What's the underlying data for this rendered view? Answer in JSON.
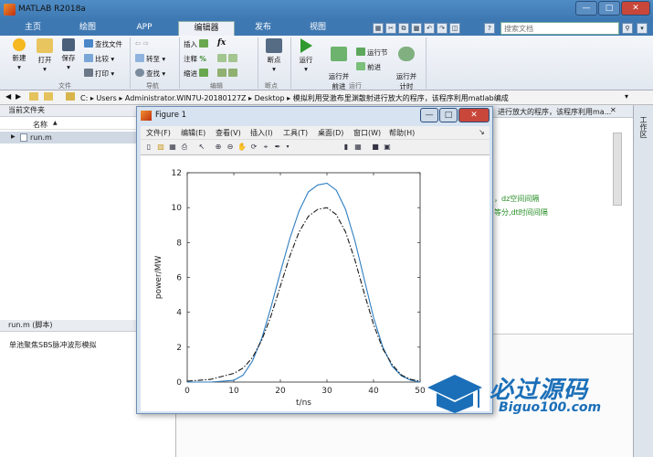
{
  "window": {
    "title": "MATLAB R2018a"
  },
  "tabs": [
    {
      "label": "主页"
    },
    {
      "label": "绘图"
    },
    {
      "label": "APP"
    },
    {
      "label": "编辑器"
    },
    {
      "label": "发布"
    },
    {
      "label": "视图"
    }
  ],
  "search": {
    "placeholder": "搜索文档"
  },
  "ribbon": {
    "file": {
      "new": "新建",
      "open": "打开",
      "save": "保存",
      "find_files": "查找文件",
      "compare": "比较",
      "print": "打印",
      "group": "文件"
    },
    "navigate": {
      "goto": "转至",
      "find": "查找",
      "group": "导航"
    },
    "edit": {
      "insert": "插入",
      "comment": "注释",
      "indent": "缩进",
      "fx": "fx",
      "group": "编辑"
    },
    "breakpoints": {
      "label": "断点",
      "group": "断点"
    },
    "run": {
      "run": "运行",
      "run_advance": "运行并\n前进",
      "run_section": "运行节",
      "advance": "前进",
      "run_time": "运行并\n计时",
      "group": "运行"
    }
  },
  "address": {
    "path": "C: ▸ Users ▸ Administrator.WIN7U-20180127Z ▸ Desktop ▸ 模拟利用受激布里渊散射进行放大的程序，该程序利用matlab编成"
  },
  "current_folder": {
    "header": "当前文件夹",
    "column_name": "名称",
    "column_sort": "▲",
    "files": [
      {
        "name": "run.m"
      }
    ]
  },
  "details": {
    "header": "run.m  (脚本)",
    "description": "单池聚焦SBS脉冲波形模拟"
  },
  "editor": {
    "tab_title": "进行放大的程序，该程序利用ma...",
    "line1": "，dz空间间隔",
    "line2": "等分,dt时间间隔"
  },
  "right_strip": {
    "label": "工作区"
  },
  "figure": {
    "title": "Figure 1",
    "menu": [
      "文件(F)",
      "编辑(E)",
      "查看(V)",
      "插入(I)",
      "工具(T)",
      "桌面(D)",
      "窗口(W)",
      "帮助(H)"
    ]
  },
  "colors": {
    "accent": "#3e78b2",
    "series1": "#2f7ec1",
    "series2": "#1a1a1a"
  },
  "watermark": {
    "title": "必过源码",
    "url": "Biguo100.com"
  },
  "chart_data": {
    "type": "line",
    "xlabel": "t/ns",
    "ylabel": "power/MW",
    "xlim": [
      0,
      50
    ],
    "ylim": [
      0,
      12
    ],
    "xticks": [
      0,
      10,
      20,
      30,
      40,
      50
    ],
    "yticks": [
      0,
      2,
      4,
      6,
      8,
      10,
      12
    ],
    "series": [
      {
        "style": "solid",
        "color": "#2f7ec1",
        "x": [
          0,
          5,
          10,
          12,
          14,
          16,
          18,
          20,
          22,
          24,
          26,
          28,
          30,
          32,
          34,
          36,
          38,
          40,
          42,
          44,
          46,
          48,
          50
        ],
        "y": [
          0,
          0,
          0.1,
          0.4,
          1.2,
          2.5,
          4.3,
          6.3,
          8.2,
          9.8,
          10.9,
          11.3,
          11.4,
          11.0,
          9.9,
          8.1,
          5.9,
          3.7,
          2.0,
          0.9,
          0.35,
          0.1,
          0
        ]
      },
      {
        "style": "dashdot",
        "color": "#1a1a1a",
        "x": [
          0,
          5,
          10,
          12,
          14,
          16,
          18,
          20,
          22,
          24,
          26,
          28,
          30,
          32,
          34,
          36,
          38,
          40,
          42,
          44,
          46,
          48,
          50
        ],
        "y": [
          0.05,
          0.15,
          0.5,
          0.8,
          1.4,
          2.4,
          3.8,
          5.5,
          7.2,
          8.6,
          9.5,
          9.9,
          10.0,
          9.6,
          8.6,
          7.0,
          5.1,
          3.3,
          1.9,
          1.0,
          0.4,
          0.15,
          0.05
        ]
      }
    ]
  }
}
